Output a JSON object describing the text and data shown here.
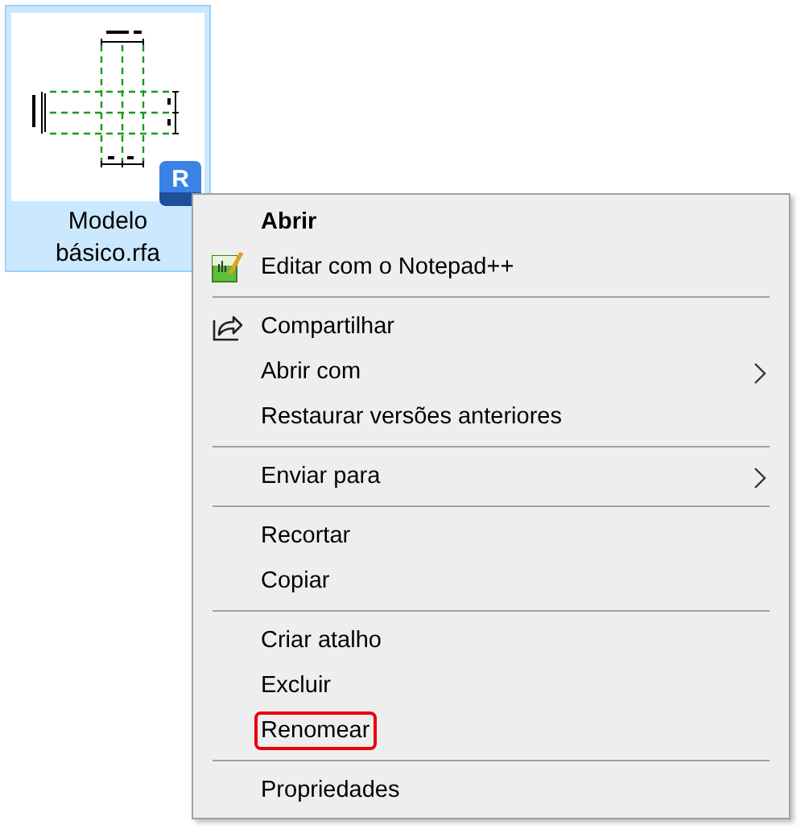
{
  "file": {
    "name_lines": [
      "Modelo",
      "básico.rfa"
    ],
    "selected": true,
    "badge": "R"
  },
  "menu": {
    "groups": [
      {
        "items": [
          {
            "label": "Abrir",
            "kind": "default",
            "submenu": false,
            "highlighted": false
          },
          {
            "label": "Editar com o Notepad++",
            "kind": "app",
            "submenu": false,
            "highlighted": false
          }
        ]
      },
      {
        "items": [
          {
            "label": "Compartilhar",
            "kind": "share",
            "submenu": false,
            "highlighted": false
          },
          {
            "label": "Abrir com",
            "kind": "plain",
            "submenu": true,
            "highlighted": false
          },
          {
            "label": "Restaurar versões anteriores",
            "kind": "plain",
            "submenu": false,
            "highlighted": false
          }
        ]
      },
      {
        "items": [
          {
            "label": "Enviar para",
            "kind": "plain",
            "submenu": true,
            "highlighted": false
          }
        ]
      },
      {
        "items": [
          {
            "label": "Recortar",
            "kind": "plain",
            "submenu": false,
            "highlighted": false
          },
          {
            "label": "Copiar",
            "kind": "plain",
            "submenu": false,
            "highlighted": false
          }
        ]
      },
      {
        "items": [
          {
            "label": "Criar atalho",
            "kind": "plain",
            "submenu": false,
            "highlighted": false
          },
          {
            "label": "Excluir",
            "kind": "plain",
            "submenu": false,
            "highlighted": false
          },
          {
            "label": "Renomear",
            "kind": "plain",
            "submenu": false,
            "highlighted": true
          }
        ]
      },
      {
        "items": [
          {
            "label": "Propriedades",
            "kind": "plain",
            "submenu": false,
            "highlighted": false
          }
        ]
      }
    ]
  }
}
